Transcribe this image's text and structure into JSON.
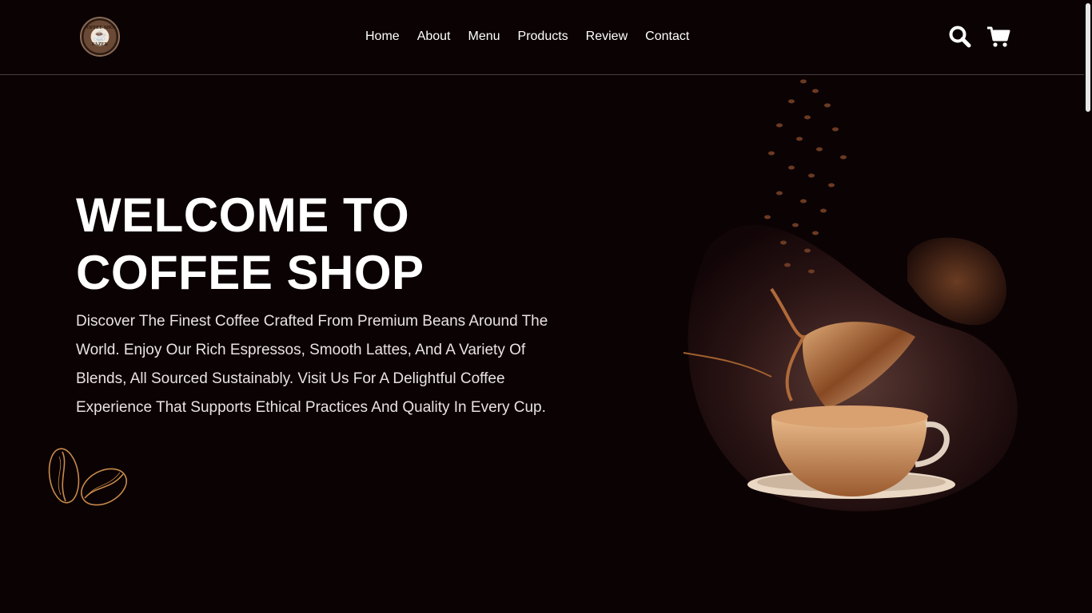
{
  "logo": {
    "text_top": "COFFEE SHOP",
    "text_bottom": "FAZER"
  },
  "nav": {
    "items": [
      {
        "label": "Home"
      },
      {
        "label": "About"
      },
      {
        "label": "Menu"
      },
      {
        "label": "Products"
      },
      {
        "label": "Review"
      },
      {
        "label": "Contact"
      }
    ]
  },
  "header_icons": {
    "search": "search-icon",
    "cart": "cart-icon"
  },
  "hero": {
    "title_line1": "WELCOME TO",
    "title_line2": "COFFEE SHOP",
    "description": "Discover The Finest Coffee Crafted From Premium Beans Around The World. Enjoy Our Rich Espressos, Smooth Lattes, And A Variety Of Blends, All Sourced Sustainably. Visit Us For A Delightful Coffee Experience That Supports Ethical Practices And Quality In Every Cup."
  },
  "colors": {
    "background": "#0b0204",
    "accent": "#c98a4a",
    "text": "#ffffff"
  }
}
